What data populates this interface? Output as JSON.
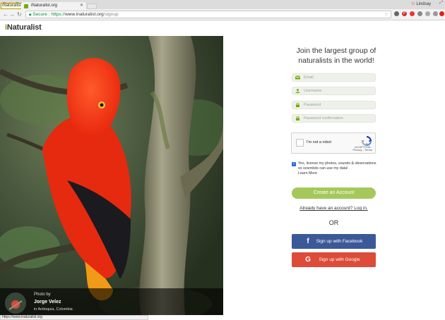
{
  "browser": {
    "tab_title": "iNaturalist.org",
    "tooltip": "iNaturalist.org",
    "profile": "Lindsay",
    "address": {
      "secure_label": "Secure",
      "scheme": "https://",
      "host": "www.inaturalist.org",
      "path": "/signup"
    },
    "status_url": "https://www.inaturalist.org"
  },
  "header": {
    "logo_i": "i",
    "logo_rest": "Naturalist"
  },
  "hero": {
    "credit_label": "Photo by",
    "photographer": "Jorge Velez",
    "location": "in Antioquia, Colombia"
  },
  "signup": {
    "headline": "Join the largest group of naturalists in the world!",
    "email_placeholder": "Email",
    "username_placeholder": "Username",
    "password_placeholder": "Password",
    "password_confirm_placeholder": "Password confirmation",
    "captcha_label": "I'm not a robot",
    "captcha_brand": "reCAPTCHA",
    "captcha_links": "Privacy - Terms",
    "license_text": "Yes, license my photos, sounds & observations so scientists can use my data!",
    "license_link": "Learn More",
    "license_checked": true,
    "create_button": "Create an Account",
    "login_link": "Already have an account? Log in.",
    "or": "OR",
    "facebook_button": "Sign up with Facebook",
    "google_button": "Sign up with Google"
  },
  "colors": {
    "brand_green": "#74ac00",
    "create_button": "#a4c95a",
    "facebook": "#3b5998",
    "google": "#dd4b39"
  }
}
